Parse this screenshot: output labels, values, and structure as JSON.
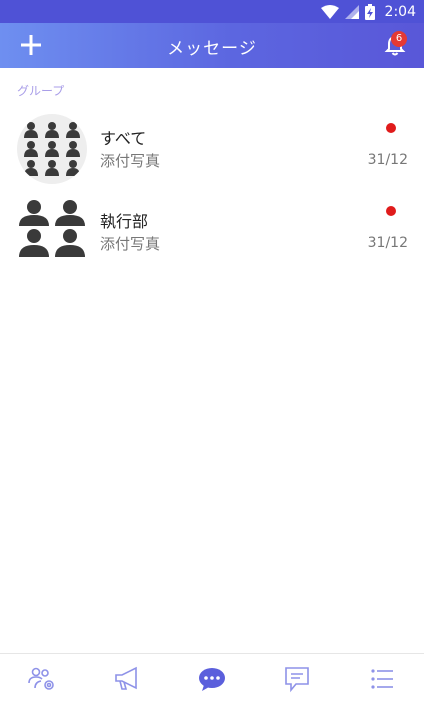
{
  "status_bar": {
    "time": "2:04",
    "icons": [
      "wifi-icon",
      "signal-icon",
      "battery-charging-icon"
    ]
  },
  "header": {
    "title": "メッセージ",
    "add_icon": "plus-icon",
    "notification_icon": "bell-icon",
    "notification_count": "6"
  },
  "section": {
    "label": "グループ"
  },
  "groups": [
    {
      "name": "すべて",
      "last_message": "添付写真",
      "date": "31/12",
      "unread": true,
      "avatar": "group-avatar-icon"
    },
    {
      "name": "執行部",
      "last_message": "添付写真",
      "date": "31/12",
      "unread": true,
      "avatar": "group-avatar-icon"
    }
  ],
  "bottom_nav": {
    "tabs": [
      {
        "icon": "group-settings-icon",
        "active": false
      },
      {
        "icon": "megaphone-icon",
        "active": false
      },
      {
        "icon": "chat-bubble-icon",
        "active": true
      },
      {
        "icon": "message-square-icon",
        "active": false
      },
      {
        "icon": "list-icon",
        "active": false
      }
    ]
  },
  "colors": {
    "accent": "#5b5fdc",
    "section_label": "#a99ee8",
    "unread_dot": "#e01b1b",
    "badge": "#e53935",
    "inactive_icon": "#8e92e8"
  }
}
